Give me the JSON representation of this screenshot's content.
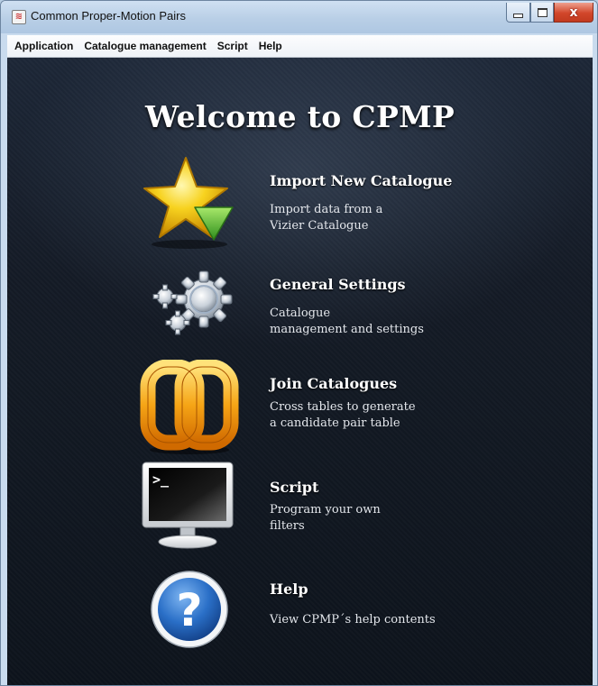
{
  "window": {
    "title": "Common Proper-Motion Pairs",
    "close_glyph": "x"
  },
  "menu": [
    "Application",
    "Catalogue management",
    "Script",
    "Help"
  ],
  "welcome": "Welcome to CPMP",
  "items": [
    {
      "title": "Import New Catalogue",
      "desc1": "Import data from a",
      "desc2": "Vizier Catalogue",
      "icon": "star-download-icon"
    },
    {
      "title": "General Settings",
      "desc1": "Catalogue",
      "desc2": "management and settings",
      "icon": "gears-icon"
    },
    {
      "title": "Join Catalogues",
      "desc1": "Cross tables to generate",
      "desc2": "a candidate pair table",
      "icon": "join-icon"
    },
    {
      "title": "Script",
      "desc1": "Program your own",
      "desc2": "filters",
      "icon": "terminal-icon"
    },
    {
      "title": "Help",
      "desc1": "View CPMP´s help contents",
      "desc2": "",
      "icon": "help-icon"
    }
  ],
  "colors": {
    "background": "#141b26",
    "accent_star": "#f5c518",
    "accent_arrow": "#5fbf3a",
    "accent_join": "#f29b12",
    "accent_help": "#2a6fc7"
  }
}
